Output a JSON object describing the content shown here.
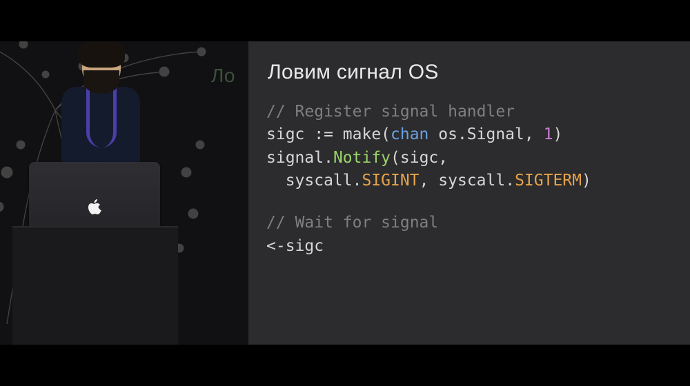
{
  "slide": {
    "title": "Ловим сигнал OS",
    "peek_title": "Ло",
    "code": {
      "comment1": "// Register signal handler",
      "line2_a": "sigc := make(",
      "line2_kw": "chan",
      "line2_b": " os.Signal, ",
      "line2_num": "1",
      "line2_c": ")",
      "line3_a": "signal.",
      "line3_fn": "Notify",
      "line3_b": "(sigc,",
      "line4_a": "  syscall.",
      "line4_c1": "SIGINT",
      "line4_b": ", syscall.",
      "line4_c2": "SIGTERM",
      "line4_c": ")",
      "comment2": "// Wait for signal",
      "line6": "<-sigc"
    }
  }
}
